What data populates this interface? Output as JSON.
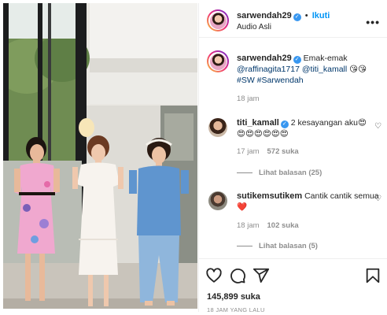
{
  "post": {
    "username": "sarwendah29",
    "follow_label": "Ikuti",
    "audio": "Audio Asli",
    "separator": "•"
  },
  "caption": {
    "username": "sarwendah29",
    "text": "Emak-emak @raffinagita1717 @titi_kamall 😘😘 #SW #Sarwendah",
    "text_main": "Emak-emak ",
    "mention1": "@raffinagita1717",
    "mention2": "@titi_kamall",
    "emoji": " 😘😘",
    "hashtags": "#SW #Sarwendah",
    "time": "18 jam"
  },
  "comments": [
    {
      "username": "titi_kamall",
      "text": "2 kesayangan aku😍",
      "emojis": "😍😍😍😍😍😍",
      "time": "17 jam",
      "likes": "572 suka",
      "replies": "Lihat balasan (25)"
    },
    {
      "username": "sutikemsutikem",
      "text": "Cantik cantik semua❤️",
      "time": "18 jam",
      "likes": "102 suka",
      "replies": "Lihat balasan (5)"
    }
  ],
  "footer": {
    "likes": "145,899 suka",
    "posted_ago": "18 JAM YANG LALU"
  },
  "icons": {
    "more": "more-options-icon",
    "like": "heart-icon",
    "comment": "comment-icon",
    "share": "paper-plane-icon",
    "save": "bookmark-icon"
  },
  "colors": {
    "verified": "#3897f0",
    "follow": "#0095f6",
    "muted": "#8e8e8e",
    "mention": "#00376b"
  }
}
